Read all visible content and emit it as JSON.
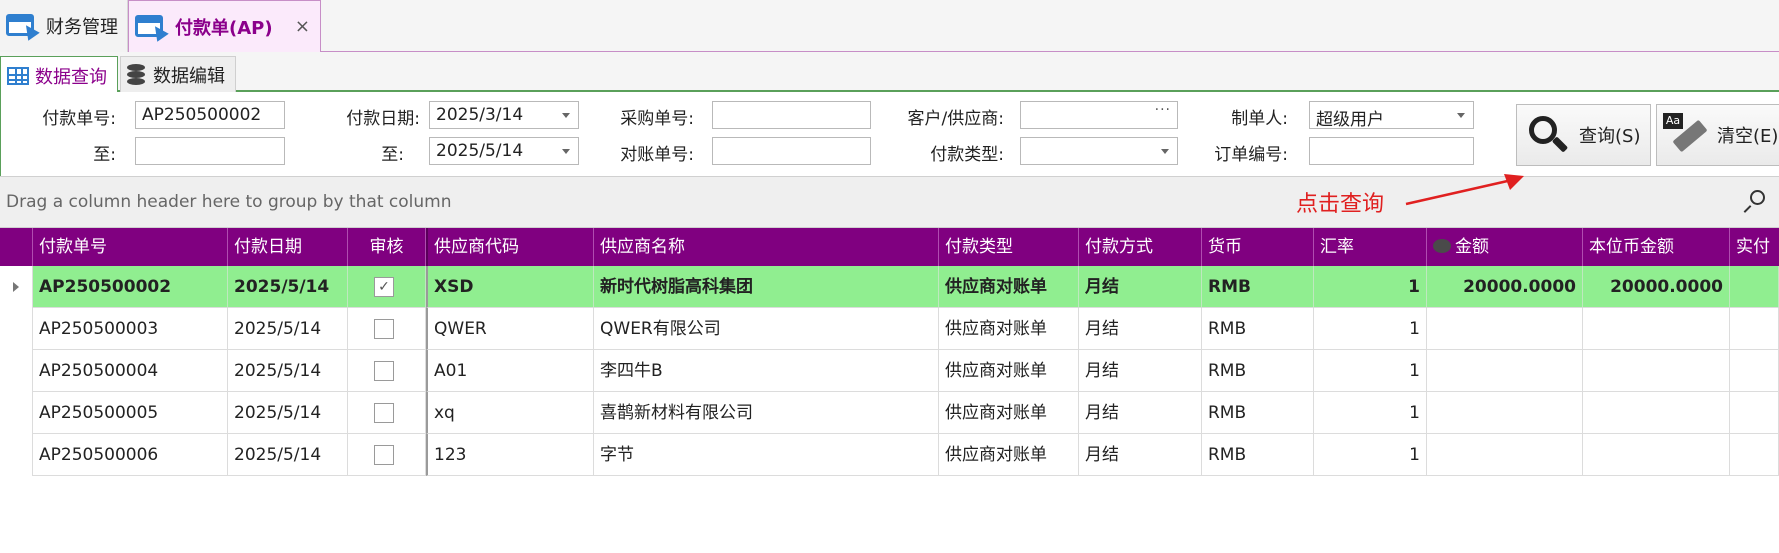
{
  "tabs": [
    {
      "label": "财务管理"
    },
    {
      "label": "付款单(AP)",
      "close": "×"
    }
  ],
  "subtabs": [
    {
      "label": "数据查询"
    },
    {
      "label": "数据编辑"
    }
  ],
  "filter": {
    "pay_no_label": "付款单号:",
    "pay_no_value": "AP250500002",
    "to_label": "至:",
    "pay_no_to_value": "",
    "pay_date_label": "付款日期:",
    "pay_date_from": "2025/3/14",
    "pay_date_to": "2025/5/14",
    "purchase_no_label": "采购单号:",
    "purchase_no_value": "",
    "recon_no_label": "对账单号:",
    "recon_no_value": "",
    "supplier_label": "客户/供应商:",
    "supplier_value": "",
    "supplier_dots": "···",
    "pay_type_label": "付款类型:",
    "pay_type_value": "",
    "creator_label": "制单人:",
    "creator_value": "超级用户",
    "order_no_label": "订单编号:",
    "order_no_value": ""
  },
  "buttons": {
    "query": "查询(S)",
    "clear": "清空(E)",
    "clear_icon_text": "Aa"
  },
  "group_panel_hint": "Drag a column header here to group by that column",
  "annotation": "点击查询",
  "columns": [
    "付款单号",
    "付款日期",
    "审核",
    "供应商代码",
    "供应商名称",
    "付款类型",
    "付款方式",
    "货币",
    "汇率",
    "金额",
    "本位币金额",
    "实付"
  ],
  "rows": [
    {
      "pay_no": "AP250500002",
      "date": "2025/5/14",
      "audited": "✓",
      "supplier_code": "XSD",
      "supplier_name": "新时代树脂高科集团",
      "pay_type": "供应商对账单",
      "pay_method": "月结",
      "currency": "RMB",
      "rate": "1",
      "amount": "20000.0000",
      "base_amount": "20000.0000",
      "paid": ""
    },
    {
      "pay_no": "AP250500003",
      "date": "2025/5/14",
      "audited": "",
      "supplier_code": "QWER",
      "supplier_name": "QWER有限公司",
      "pay_type": "供应商对账单",
      "pay_method": "月结",
      "currency": "RMB",
      "rate": "1",
      "amount": "",
      "base_amount": "",
      "paid": ""
    },
    {
      "pay_no": "AP250500004",
      "date": "2025/5/14",
      "audited": "",
      "supplier_code": "A01",
      "supplier_name": "李四牛B",
      "pay_type": "供应商对账单",
      "pay_method": "月结",
      "currency": "RMB",
      "rate": "1",
      "amount": "",
      "base_amount": "",
      "paid": ""
    },
    {
      "pay_no": "AP250500005",
      "date": "2025/5/14",
      "audited": "",
      "supplier_code": "xq",
      "supplier_name": "喜鹊新材料有限公司",
      "pay_type": "供应商对账单",
      "pay_method": "月结",
      "currency": "RMB",
      "rate": "1",
      "amount": "",
      "base_amount": "",
      "paid": ""
    },
    {
      "pay_no": "AP250500006",
      "date": "2025/5/14",
      "audited": "",
      "supplier_code": "123",
      "supplier_name": "字节",
      "pay_type": "供应商对账单",
      "pay_method": "月结",
      "currency": "RMB",
      "rate": "1",
      "amount": "",
      "base_amount": "",
      "paid": ""
    }
  ],
  "colors": {
    "header_bg": "#800080",
    "selected_row": "#90ee90",
    "annotation": "#e02020"
  }
}
